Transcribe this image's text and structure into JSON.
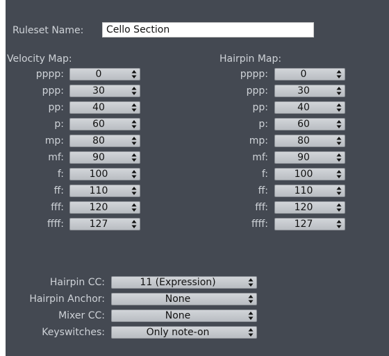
{
  "ruleset": {
    "label": "Ruleset Name:",
    "value": "Cello Section"
  },
  "velocity": {
    "title": "Velocity Map:",
    "rows": [
      {
        "label": "pppp:",
        "value": "0"
      },
      {
        "label": "ppp:",
        "value": "30"
      },
      {
        "label": "pp:",
        "value": "40"
      },
      {
        "label": "p:",
        "value": "60"
      },
      {
        "label": "mp:",
        "value": "80"
      },
      {
        "label": "mf:",
        "value": "90"
      },
      {
        "label": "f:",
        "value": "100"
      },
      {
        "label": "ff:",
        "value": "110"
      },
      {
        "label": "fff:",
        "value": "120"
      },
      {
        "label": "ffff:",
        "value": "127"
      }
    ]
  },
  "hairpin": {
    "title": "Hairpin Map:",
    "rows": [
      {
        "label": "pppp:",
        "value": "0"
      },
      {
        "label": "ppp:",
        "value": "30"
      },
      {
        "label": "pp:",
        "value": "40"
      },
      {
        "label": "p:",
        "value": "60"
      },
      {
        "label": "mp:",
        "value": "80"
      },
      {
        "label": "mf:",
        "value": "90"
      },
      {
        "label": "f:",
        "value": "100"
      },
      {
        "label": "ff:",
        "value": "110"
      },
      {
        "label": "fff:",
        "value": "120"
      },
      {
        "label": "ffff:",
        "value": "127"
      }
    ]
  },
  "settings": [
    {
      "label": "Hairpin CC:",
      "value": "11 (Expression)"
    },
    {
      "label": "Hairpin Anchor:",
      "value": "None"
    },
    {
      "label": "Mixer CC:",
      "value": "None"
    },
    {
      "label": "Keyswitches:",
      "value": "Only note-on"
    }
  ],
  "colors": {
    "panel": "#444952",
    "label": "#cfd3d8"
  },
  "icons": {
    "stepper_arrow": "up-down-chevron-icon"
  }
}
